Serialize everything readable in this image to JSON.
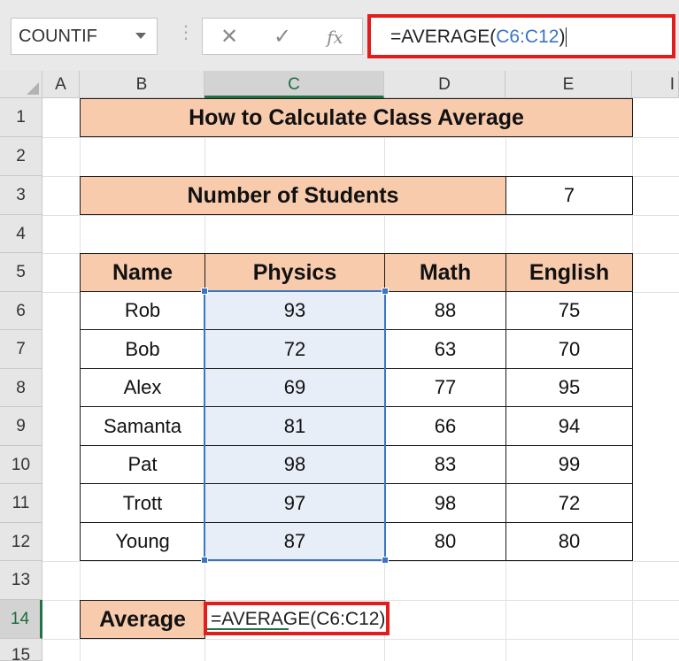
{
  "name_box": {
    "value": "COUNTIF"
  },
  "formula_bar": {
    "prefix": "=AVERAGE(",
    "ref": "C6:C12",
    "suffix": ")"
  },
  "columns": [
    "A",
    "B",
    "C",
    "D",
    "E",
    "I"
  ],
  "rows": [
    "1",
    "2",
    "3",
    "4",
    "5",
    "6",
    "7",
    "8",
    "9",
    "10",
    "11",
    "12",
    "13",
    "14",
    "15"
  ],
  "sheet": {
    "title": "How to Calculate Class Average",
    "students_label": "Number of Students",
    "students_value": "7",
    "headers": [
      "Name",
      "Physics",
      "Math",
      "English"
    ],
    "records": [
      [
        "Rob",
        "93",
        "88",
        "75"
      ],
      [
        "Bob",
        "72",
        "63",
        "70"
      ],
      [
        "Alex",
        "69",
        "77",
        "95"
      ],
      [
        "Samanta",
        "81",
        "66",
        "94"
      ],
      [
        "Pat",
        "98",
        "83",
        "99"
      ],
      [
        "Trott",
        "97",
        "98",
        "72"
      ],
      [
        "Young",
        "87",
        "80",
        "80"
      ]
    ],
    "average_label": "Average",
    "average_formula": "=AVERAGE(C6:C12)"
  },
  "colors": {
    "header_fill": "#f8cbad",
    "highlight": "#e31c1c",
    "selection": "#3a74c5",
    "excel_green": "#217346"
  }
}
